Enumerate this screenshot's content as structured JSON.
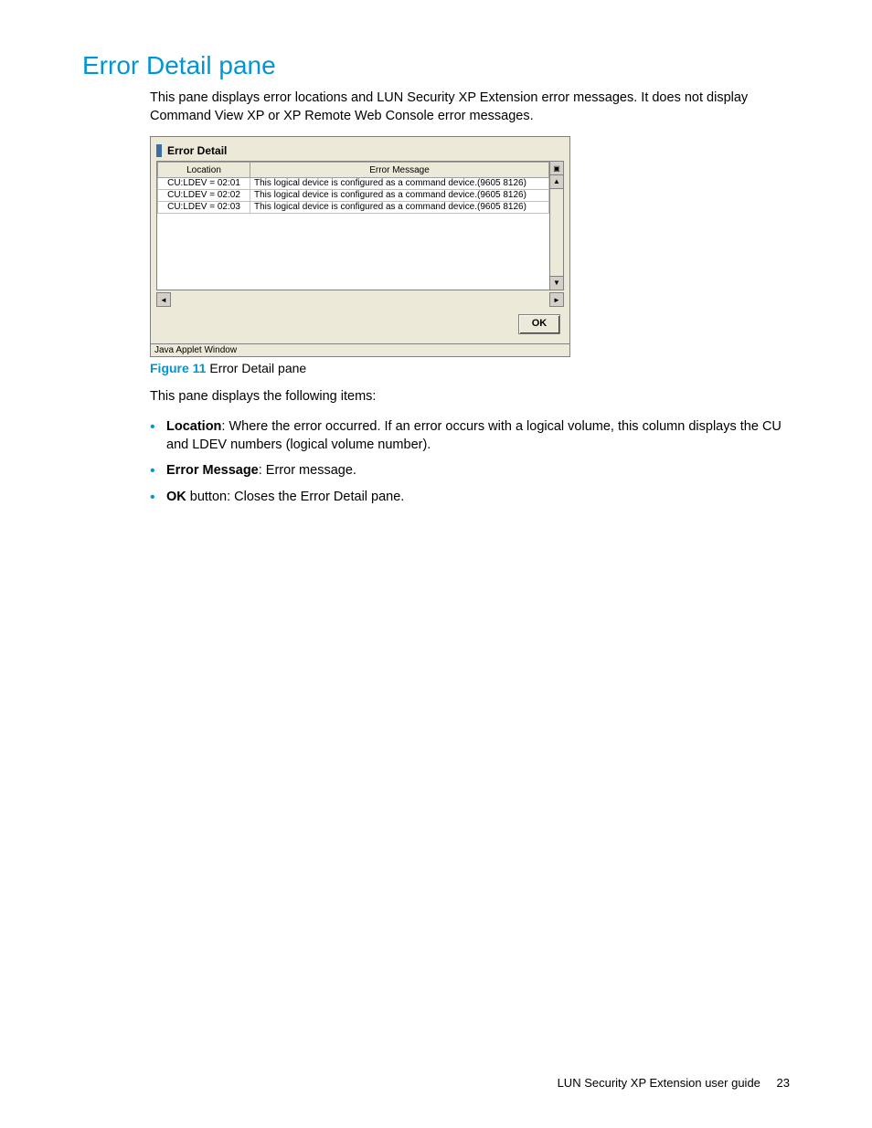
{
  "heading": "Error Detail pane",
  "intro": "This pane displays error locations and LUN Security XP Extension error messages. It does not display Command View XP or XP Remote Web Console error messages.",
  "applet": {
    "title": "Error Detail",
    "columns": {
      "location": "Location",
      "message": "Error Message"
    },
    "rows": [
      {
        "location": "CU:LDEV = 02:01",
        "message": "This logical device is configured as a command device.(9605 8126)"
      },
      {
        "location": "CU:LDEV = 02:02",
        "message": "This logical device is configured as a command device.(9605 8126)"
      },
      {
        "location": "CU:LDEV = 02:03",
        "message": "This logical device is configured as a command device.(9605 8126)"
      }
    ],
    "ok_label": "OK",
    "status": "Java Applet Window"
  },
  "figure": {
    "label": "Figure 11",
    "caption": "Error Detail pane"
  },
  "items_intro": "This pane displays the following items:",
  "bullets": [
    {
      "term": "Location",
      "text": ": Where the error occurred. If an error occurs with a logical volume, this column displays the CU and LDEV numbers (logical volume number)."
    },
    {
      "term": "Error Message",
      "text": ": Error message."
    },
    {
      "term": "OK",
      "text": " button: Closes the Error Detail pane."
    }
  ],
  "footer": {
    "title": "LUN Security XP Extension user guide",
    "page": "23"
  }
}
